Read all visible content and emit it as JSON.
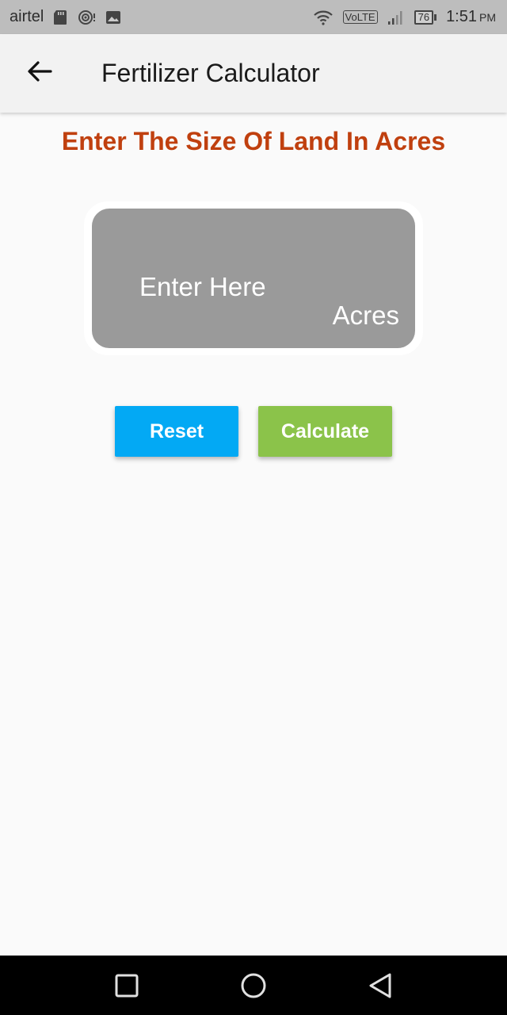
{
  "status_bar": {
    "carrier": "airtel",
    "network_badge": "VoLTE",
    "battery_level": "76",
    "time": "1:51",
    "ampm": "PM",
    "icons": [
      "sd-card-icon",
      "hotspot-icon",
      "gallery-icon",
      "wifi-icon",
      "signal-icon",
      "battery-icon"
    ]
  },
  "app_bar": {
    "back_icon": "arrow-left-icon",
    "title": "Fertilizer Calculator"
  },
  "main": {
    "heading": "Enter The Size Of Land In Acres",
    "land_input": {
      "placeholder": "Enter Here",
      "value": "",
      "suffix": "Acres"
    },
    "buttons": {
      "reset_label": "Reset",
      "calculate_label": "Calculate"
    }
  },
  "nav_bar": {
    "icons": [
      "recent-apps-icon",
      "home-icon",
      "back-triangle-icon"
    ]
  },
  "colors": {
    "heading": "#c0400f",
    "input_bg": "#9a9a9a",
    "reset": "#03a9f4",
    "calculate": "#8bc34a",
    "app_bar": "#f2f2f2",
    "status_bar": "#bdbdbd"
  }
}
